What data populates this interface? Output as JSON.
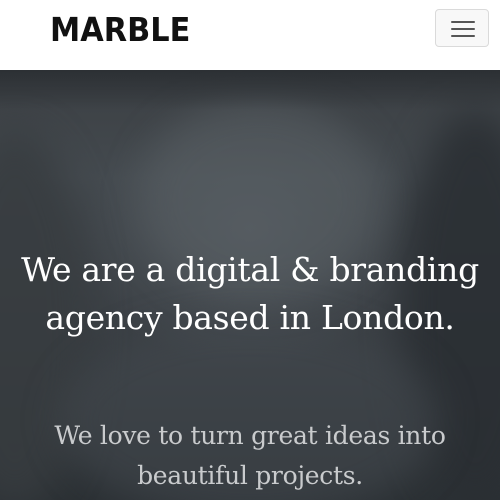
{
  "navbar": {
    "brand": "MARBLE",
    "menu_toggle_icon": "hamburger-menu-icon"
  },
  "hero": {
    "headline_line1": "We are a digital & branding",
    "headline_line2": "agency based in London.",
    "subline_line1": "We love to turn great ideas into",
    "subline_line2": "beautiful projects."
  },
  "colors": {
    "navbar_bg": "#ffffff",
    "brand_text": "#111111",
    "hero_bg": "#3c4146",
    "headline_text": "#ffffff",
    "subline_text": "#c9cbcd"
  }
}
